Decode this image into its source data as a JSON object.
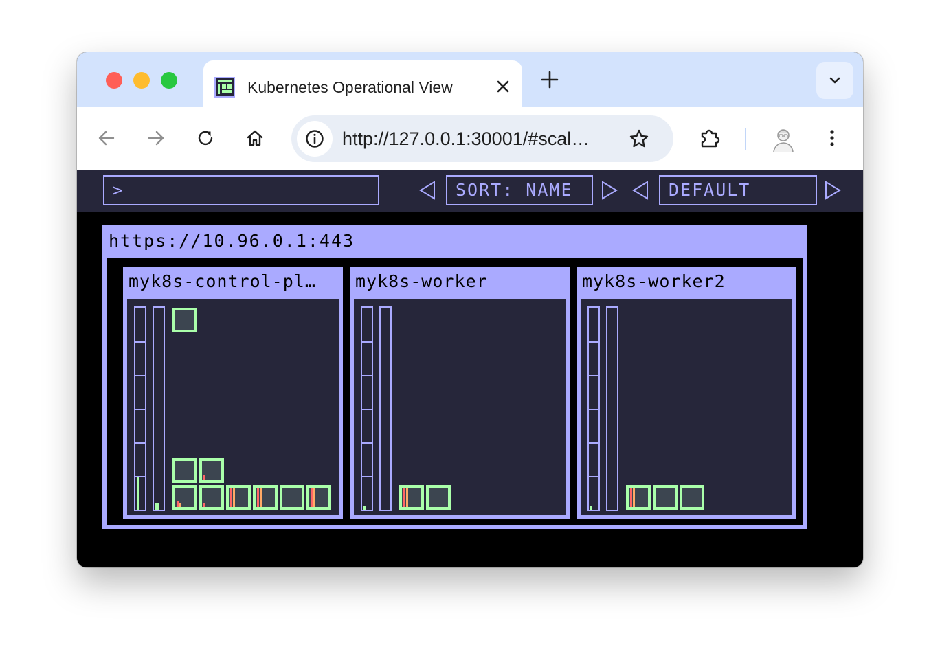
{
  "browser": {
    "tab_title": "Kubernetes Operational View",
    "url": "http://127.0.0.1:30001/#scal…"
  },
  "app": {
    "filter_prompt": ">",
    "sort_label": "SORT: NAME",
    "theme_label": "DEFAULT",
    "colors": {
      "primary": "#aaaaff",
      "pod_ok": "#aaffaa",
      "background": "#000000",
      "panel": "#26263a",
      "cpu": "#ff6666",
      "memory": "#ffaa66"
    }
  },
  "cluster": {
    "api_server_url": "https://10.96.0.1:443",
    "nodes": [
      {
        "name": "myk8s-control-pl…",
        "cpu_fraction": 0.16,
        "memory_fraction": 0.03,
        "pods": [
          {
            "cpu": 0.0,
            "memory": 0.0
          },
          {
            "cpu": 0.0,
            "memory": 0.0
          },
          {
            "cpu": 0.3,
            "memory": 0.0
          },
          {
            "cpu": 0.3,
            "memory": 0.2
          },
          {
            "cpu": 0.2,
            "memory": 0.0
          },
          {
            "cpu": 0.95,
            "memory": 0.95
          },
          {
            "cpu": 0.95,
            "memory": 0.95
          },
          {
            "cpu": 0.0,
            "memory": 0.0
          },
          {
            "cpu": 0.95,
            "memory": 0.95
          }
        ]
      },
      {
        "name": "myk8s-worker",
        "cpu_fraction": 0.02,
        "memory_fraction": 0.0,
        "pods": [
          {
            "cpu": 0.95,
            "memory": 0.95
          },
          {
            "cpu": 0.0,
            "memory": 0.0
          }
        ]
      },
      {
        "name": "myk8s-worker2",
        "cpu_fraction": 0.02,
        "memory_fraction": 0.0,
        "pods": [
          {
            "cpu": 0.95,
            "memory": 0.95
          },
          {
            "cpu": 0.0,
            "memory": 0.0
          },
          {
            "cpu": 0.0,
            "memory": 0.0
          }
        ]
      }
    ]
  }
}
